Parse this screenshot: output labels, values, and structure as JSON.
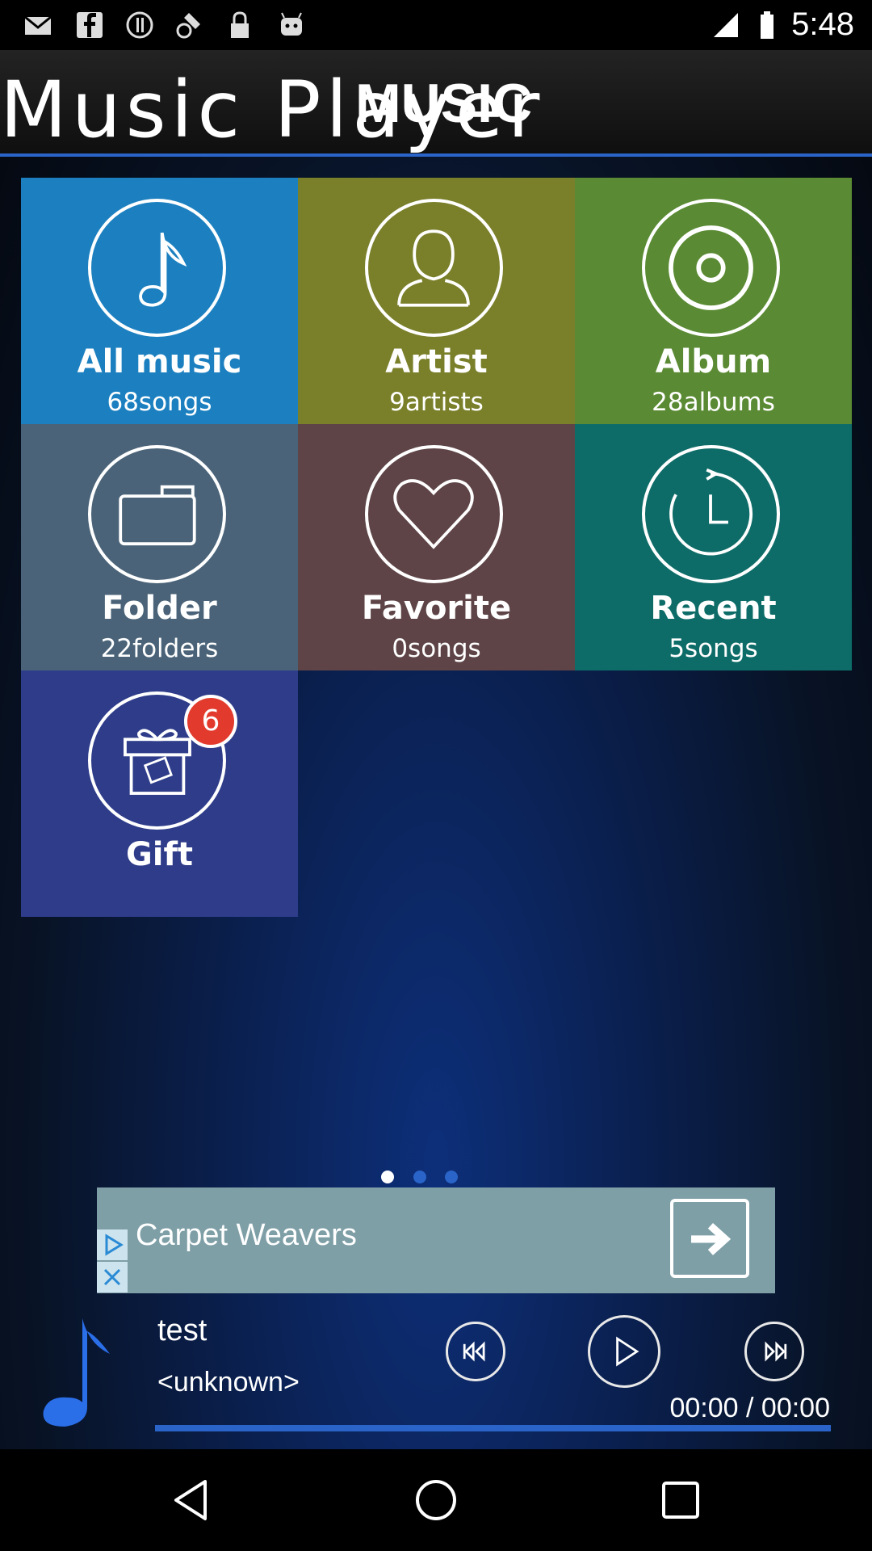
{
  "status_bar": {
    "time": "5:48",
    "icons": [
      "mail-icon",
      "facebook-icon",
      "info-circle-icon",
      "fake-gps-icon",
      "lock-icon",
      "android-icon",
      "signal-icon",
      "battery-icon"
    ]
  },
  "header": {
    "title": "Music Player",
    "subtitle": "MUSIC"
  },
  "tiles": [
    {
      "label": "All music",
      "sub": "68songs",
      "icon": "music-note-icon",
      "color": "#1c80c0"
    },
    {
      "label": "Artist",
      "sub": "9artists",
      "icon": "person-icon",
      "color": "#7a7f2a"
    },
    {
      "label": "Album",
      "sub": "28albums",
      "icon": "disc-icon",
      "color": "#5a8a33"
    },
    {
      "label": "Folder",
      "sub": "22folders",
      "icon": "folder-icon",
      "color": "#4a6378"
    },
    {
      "label": "Favorite",
      "sub": "0songs",
      "icon": "heart-icon",
      "color": "#5e4447"
    },
    {
      "label": "Recent",
      "sub": "5songs",
      "icon": "clock-icon",
      "color": "#0e6c68"
    },
    {
      "label": "Gift",
      "sub": "",
      "icon": "gift-icon",
      "color": "#2e3c8a",
      "badge": "6"
    }
  ],
  "pager": {
    "count": 3,
    "active": 0
  },
  "ad": {
    "text": "Carpet Weavers"
  },
  "player": {
    "track": "test",
    "artist": "<unknown>",
    "time": "00:00 / 00:00",
    "progress": 1.0
  }
}
